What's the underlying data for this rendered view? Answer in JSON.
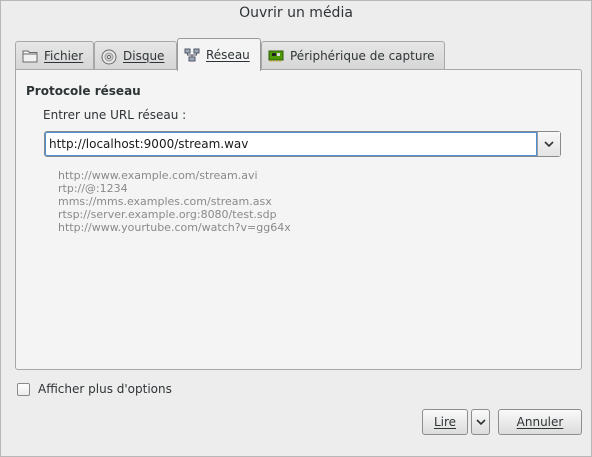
{
  "window": {
    "title": "Ouvrir un média"
  },
  "tabs": [
    {
      "label": "Fichier",
      "icon": "folder-icon",
      "active": false
    },
    {
      "label": "Disque",
      "icon": "disc-icon",
      "active": false
    },
    {
      "label": "Réseau",
      "icon": "network-icon",
      "active": true
    },
    {
      "label": "Périphérique de capture",
      "icon": "capture-card-icon",
      "active": false
    }
  ],
  "network": {
    "section_title": "Protocole réseau",
    "url_label": "Entrer une URL réseau :",
    "url_value": "http://localhost:9000/stream.wav",
    "examples": [
      "http://www.example.com/stream.avi",
      "rtp://@:1234",
      "mms://mms.examples.com/stream.asx",
      "rtsp://server.example.org:8080/test.sdp",
      "http://www.yourtube.com/watch?v=gg64x"
    ]
  },
  "options": {
    "more_options_label": "Afficher plus d'options",
    "checked": false
  },
  "buttons": {
    "play_label": "Lire",
    "cancel_label": "Annuler"
  }
}
